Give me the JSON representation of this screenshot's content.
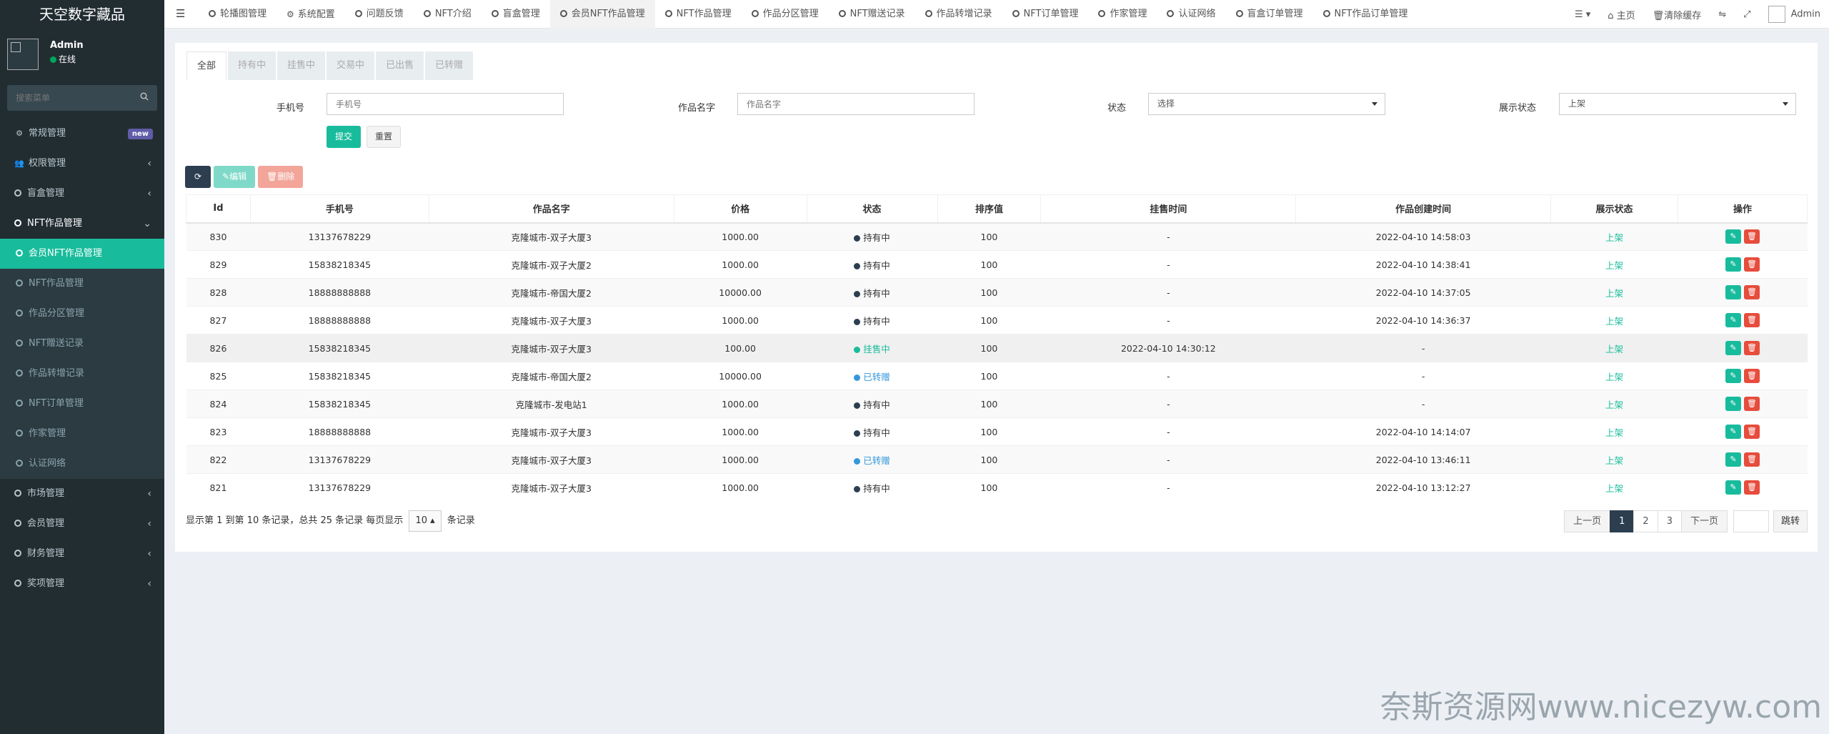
{
  "app": {
    "title": "天空数字藏品"
  },
  "user": {
    "name": "Admin",
    "status": "在线"
  },
  "sidebar": {
    "search_placeholder": "搜索菜单",
    "items": [
      {
        "label": "常规管理",
        "icon": "cogs-icon",
        "badge": "new"
      },
      {
        "label": "权限管理",
        "icon": "users-icon"
      },
      {
        "label": "盲盒管理",
        "icon": "circle-icon"
      },
      {
        "label": "NFT作品管理",
        "icon": "circle-icon"
      },
      {
        "label": "市场管理",
        "icon": "circle-icon"
      },
      {
        "label": "会员管理",
        "icon": "circle-icon"
      },
      {
        "label": "财务管理",
        "icon": "circle-icon"
      },
      {
        "label": "奖项管理",
        "icon": "circle-icon"
      }
    ],
    "sub_items": [
      {
        "label": "会员NFT作品管理"
      },
      {
        "label": "NFT作品管理"
      },
      {
        "label": "作品分区管理"
      },
      {
        "label": "NFT赠送记录"
      },
      {
        "label": "作品转增记录"
      },
      {
        "label": "NFT订单管理"
      },
      {
        "label": "作家管理"
      },
      {
        "label": "认证网络"
      }
    ]
  },
  "topnav": {
    "tabs": [
      {
        "label": "轮播图管理"
      },
      {
        "label": "系统配置"
      },
      {
        "label": "问题反馈"
      },
      {
        "label": "NFT介绍"
      },
      {
        "label": "盲盒管理"
      },
      {
        "label": "会员NFT作品管理"
      },
      {
        "label": "NFT作品管理"
      },
      {
        "label": "作品分区管理"
      },
      {
        "label": "NFT赠送记录"
      },
      {
        "label": "作品转增记录"
      },
      {
        "label": "NFT订单管理"
      },
      {
        "label": "作家管理"
      },
      {
        "label": "认证网络"
      },
      {
        "label": "盲盒订单管理"
      },
      {
        "label": "NFT作品订单管理"
      }
    ],
    "home": "主页",
    "clear_cache": "清除缓存",
    "user": "Admin"
  },
  "filter_tabs": [
    "全部",
    "持有中",
    "挂售中",
    "交易中",
    "已出售",
    "已转赠"
  ],
  "form": {
    "phone_label": "手机号",
    "phone_placeholder": "手机号",
    "name_label": "作品名字",
    "name_placeholder": "作品名字",
    "status_label": "状态",
    "status_value": "选择",
    "display_label": "展示状态",
    "display_value": "上架",
    "submit": "提交",
    "reset": "重置"
  },
  "toolbar": {
    "edit": "编辑",
    "delete": "删除"
  },
  "table": {
    "columns": [
      "Id",
      "手机号",
      "作品名字",
      "价格",
      "状态",
      "排序值",
      "挂售时间",
      "作品创建时间",
      "展示状态",
      "操作"
    ],
    "rows": [
      {
        "id": "830",
        "phone": "13137678229",
        "name": "克隆城市-双子大厦3",
        "price": "1000.00",
        "status": "持有中",
        "status_color": "#2c3e50",
        "sort": "100",
        "sale_time": "-",
        "created": "2022-04-10 14:58:03",
        "display": "上架"
      },
      {
        "id": "829",
        "phone": "15838218345",
        "name": "克隆城市-双子大厦2",
        "price": "1000.00",
        "status": "持有中",
        "status_color": "#2c3e50",
        "sort": "100",
        "sale_time": "-",
        "created": "2022-04-10 14:38:41",
        "display": "上架"
      },
      {
        "id": "828",
        "phone": "18888888888",
        "name": "克隆城市-帝国大厦2",
        "price": "10000.00",
        "status": "持有中",
        "status_color": "#2c3e50",
        "sort": "100",
        "sale_time": "-",
        "created": "2022-04-10 14:37:05",
        "display": "上架"
      },
      {
        "id": "827",
        "phone": "18888888888",
        "name": "克隆城市-双子大厦3",
        "price": "1000.00",
        "status": "持有中",
        "status_color": "#2c3e50",
        "sort": "100",
        "sale_time": "-",
        "created": "2022-04-10 14:36:37",
        "display": "上架"
      },
      {
        "id": "826",
        "phone": "15838218345",
        "name": "克隆城市-双子大厦3",
        "price": "100.00",
        "status": "挂售中",
        "status_color": "#18bc9c",
        "sort": "100",
        "sale_time": "2022-04-10 14:30:12",
        "created": "-",
        "display": "上架"
      },
      {
        "id": "825",
        "phone": "15838218345",
        "name": "克隆城市-帝国大厦2",
        "price": "10000.00",
        "status": "已转赠",
        "status_color": "#3498db",
        "sort": "100",
        "sale_time": "-",
        "created": "-",
        "display": "上架"
      },
      {
        "id": "824",
        "phone": "15838218345",
        "name": "克隆城市-发电站1",
        "price": "1000.00",
        "status": "持有中",
        "status_color": "#2c3e50",
        "sort": "100",
        "sale_time": "-",
        "created": "-",
        "display": "上架"
      },
      {
        "id": "823",
        "phone": "18888888888",
        "name": "克隆城市-双子大厦3",
        "price": "1000.00",
        "status": "持有中",
        "status_color": "#2c3e50",
        "sort": "100",
        "sale_time": "-",
        "created": "2022-04-10 14:14:07",
        "display": "上架"
      },
      {
        "id": "822",
        "phone": "13137678229",
        "name": "克隆城市-双子大厦3",
        "price": "1000.00",
        "status": "已转赠",
        "status_color": "#3498db",
        "sort": "100",
        "sale_time": "-",
        "created": "2022-04-10 13:46:11",
        "display": "上架"
      },
      {
        "id": "821",
        "phone": "13137678229",
        "name": "克隆城市-双子大厦3",
        "price": "1000.00",
        "status": "持有中",
        "status_color": "#2c3e50",
        "sort": "100",
        "sale_time": "-",
        "created": "2022-04-10 13:12:27",
        "display": "上架"
      }
    ]
  },
  "pagination": {
    "info_prefix": "显示第 1 到第 10 条记录，总共 25 条记录 每页显示",
    "page_size": "10",
    "info_suffix": "条记录",
    "prev": "上一页",
    "pages": [
      "1",
      "2",
      "3"
    ],
    "next": "下一页",
    "jump": "跳转"
  },
  "watermark": "奈斯资源网www.nicezyw.com",
  "colors": {
    "accent": "#18bc9c",
    "sidebar_bg": "#222d32",
    "danger": "#e74c3c",
    "dark": "#2c3e50"
  }
}
